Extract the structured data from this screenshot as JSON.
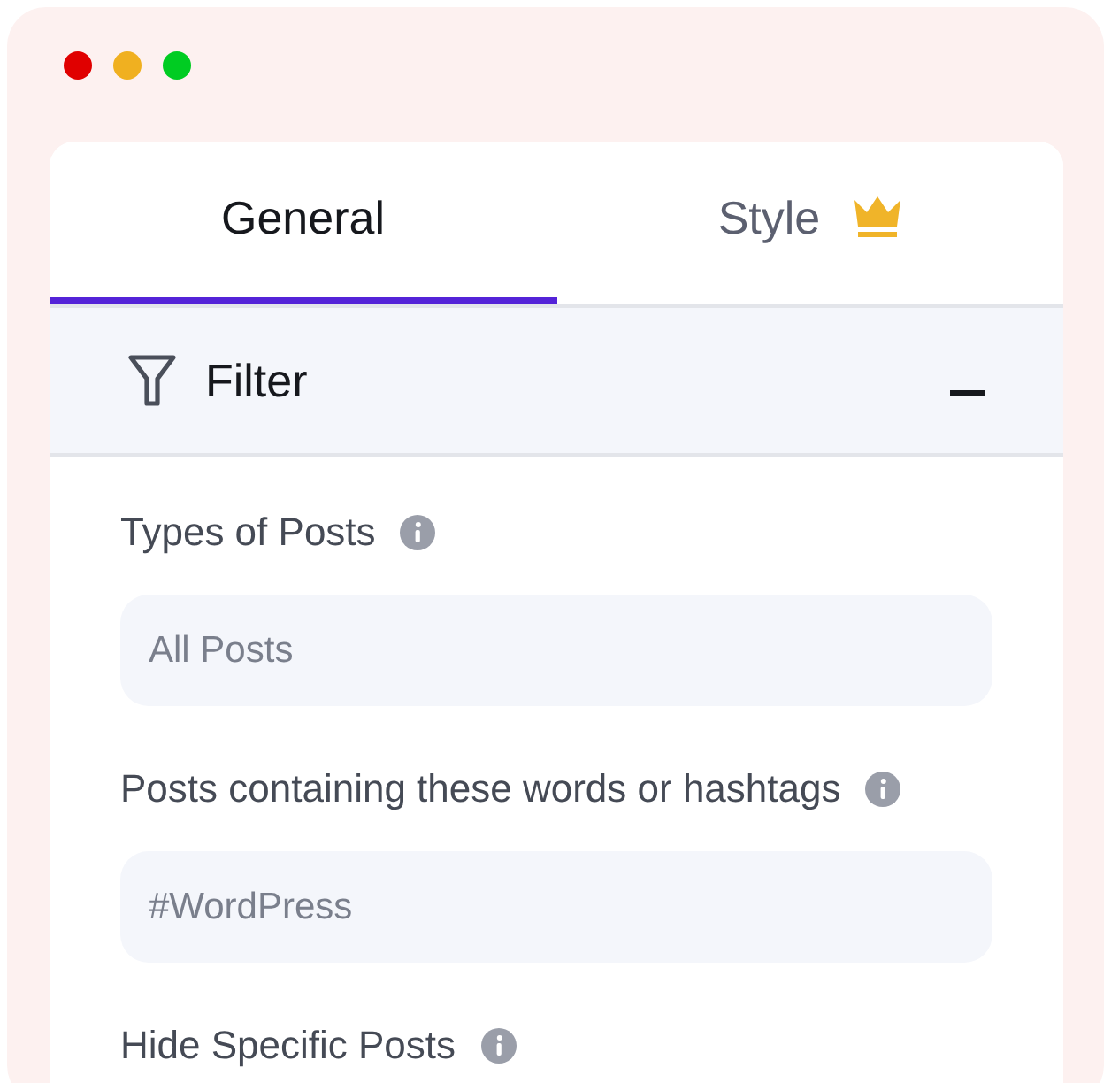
{
  "window": {
    "controls": [
      {
        "color": "#e00000"
      },
      {
        "color": "#f0b020"
      },
      {
        "color": "#00cc22"
      }
    ]
  },
  "tabs": [
    {
      "label": "General",
      "selected": true,
      "premium": false
    },
    {
      "label": "Style",
      "selected": false,
      "premium": true
    }
  ],
  "section": {
    "title": "Filter",
    "expanded": true
  },
  "fields": [
    {
      "label": "Types of Posts",
      "kind": "select",
      "value": "All Posts"
    },
    {
      "label": "Posts containing these words or hashtags",
      "kind": "text",
      "placeholder": "#WordPress"
    },
    {
      "label": "Hide Specific Posts",
      "kind": "label_only"
    }
  ]
}
